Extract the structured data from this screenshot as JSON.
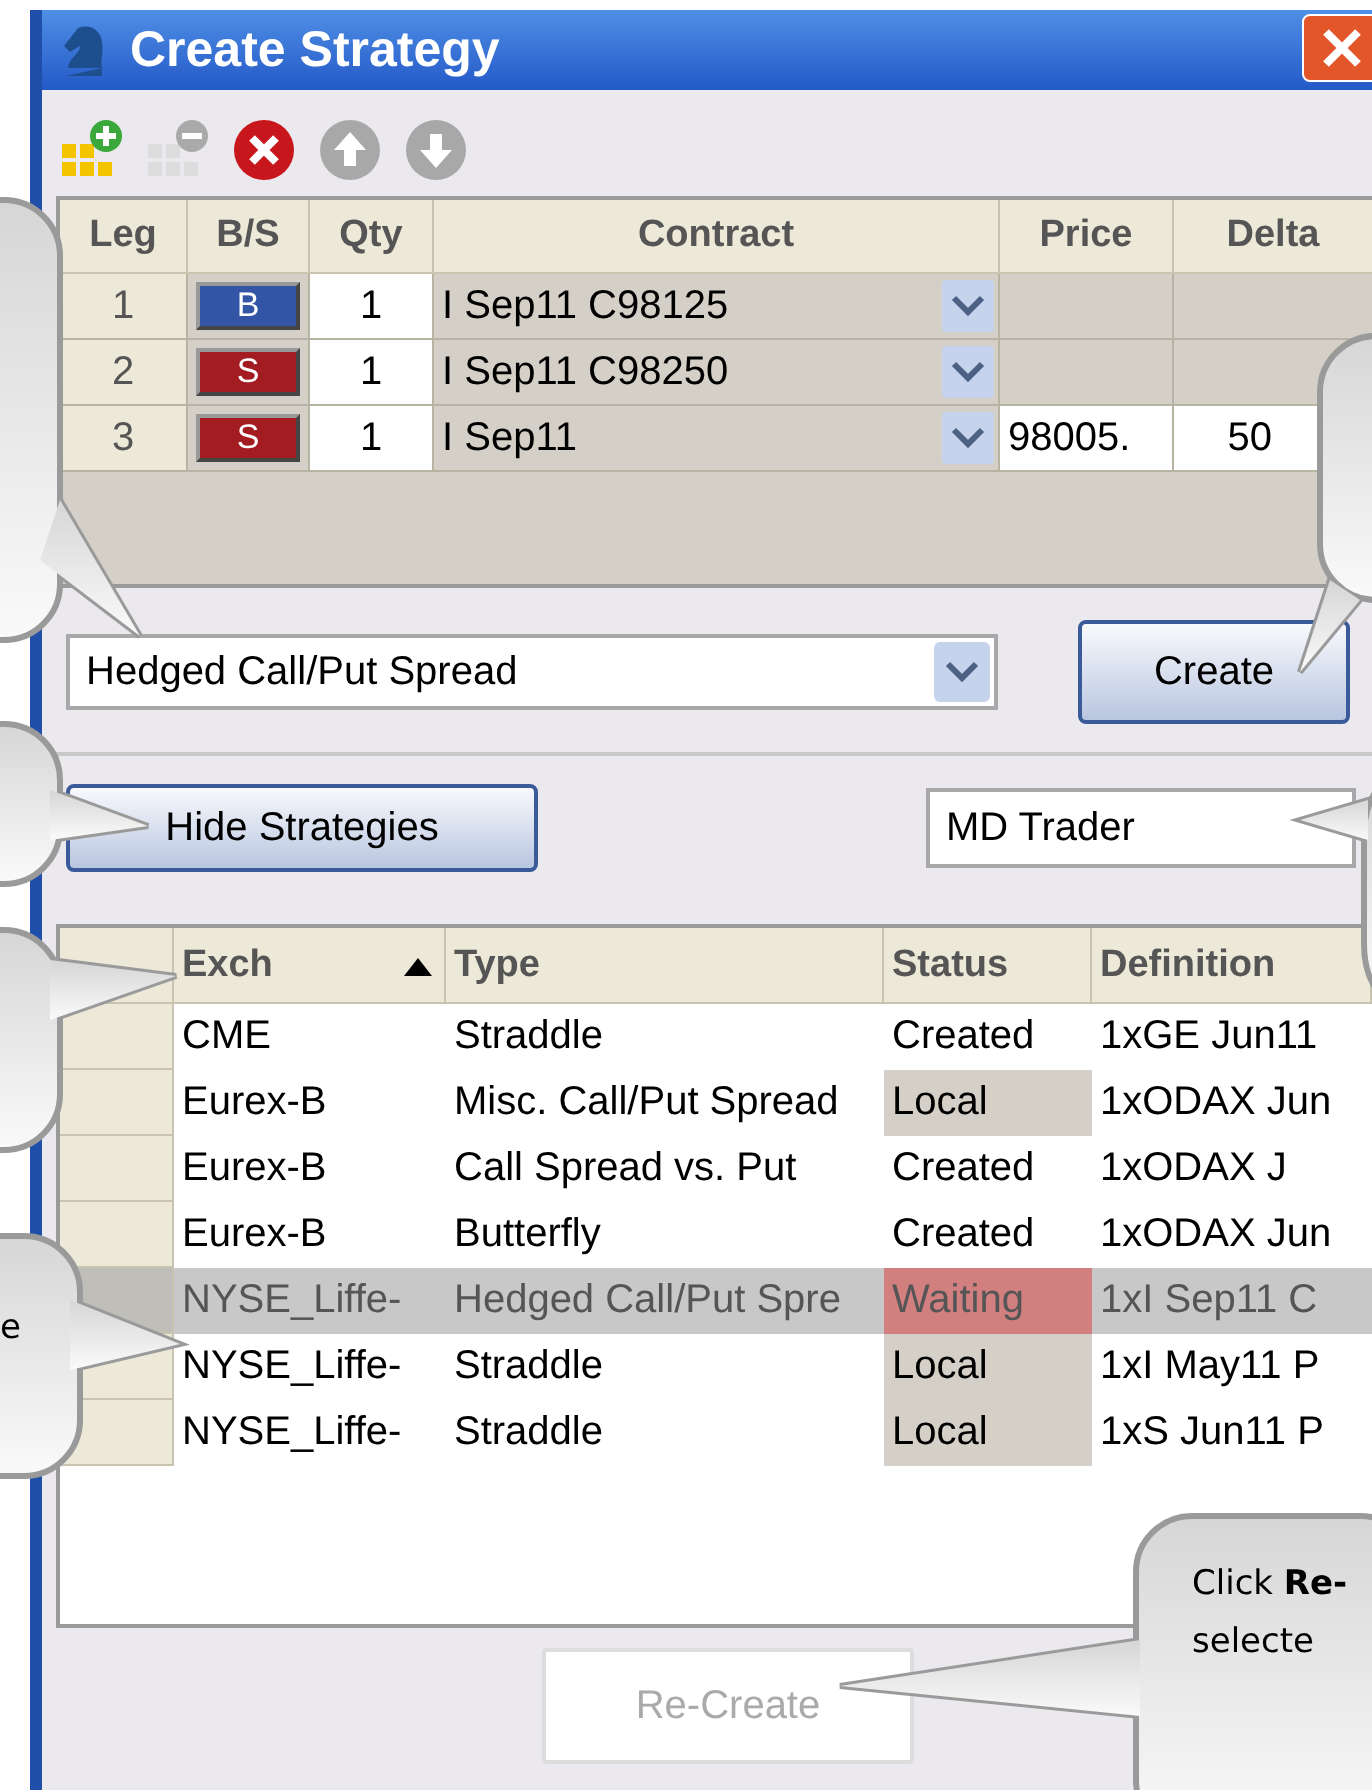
{
  "window": {
    "title": "Create Strategy"
  },
  "legs": {
    "columns": [
      "Leg",
      "B/S",
      "Qty",
      "Contract",
      "Price",
      "Delta"
    ],
    "rows": [
      {
        "leg": "1",
        "side": "B",
        "kind": "buy",
        "qty": "1",
        "contract": "I Sep11 C98125",
        "price": "",
        "delta": ""
      },
      {
        "leg": "2",
        "side": "S",
        "kind": "sell",
        "qty": "1",
        "contract": "I Sep11 C98250",
        "price": "",
        "delta": ""
      },
      {
        "leg": "3",
        "side": "S",
        "kind": "sell",
        "qty": "1",
        "contract": "I Sep11",
        "price": "98005.",
        "delta": "50"
      }
    ]
  },
  "strategy_type": {
    "value": "Hedged Call/Put Spread"
  },
  "create_button": "Create",
  "hide_button": "Hide Strategies",
  "launcher": {
    "value": "MD Trader"
  },
  "strategies": {
    "columns": [
      "Exch",
      "Type",
      "Status",
      "Definition"
    ],
    "rows": [
      {
        "exch": "CME",
        "type": "Straddle",
        "status": "Created",
        "color": "#ffffff",
        "definition": "1xGE Jun11",
        "selected": false
      },
      {
        "exch": "Eurex-B",
        "type": "Misc. Call/Put Spread",
        "status": "Local",
        "color": "#d4d0c8",
        "definition": "1xODAX Jun",
        "selected": false
      },
      {
        "exch": "Eurex-B",
        "type": "Call Spread vs. Put",
        "status": "Created",
        "color": "#ffffff",
        "definition": "1xODAX J",
        "selected": false
      },
      {
        "exch": "Eurex-B",
        "type": "Butterfly",
        "status": "Created",
        "color": "#ffffff",
        "definition": "1xODAX Jun",
        "selected": false
      },
      {
        "exch": "NYSE_Liffe-",
        "type": "Hedged Call/Put Spre",
        "status": "Waiting",
        "color": "#d27f80",
        "definition": "1xI Sep11 C",
        "selected": true
      },
      {
        "exch": "NYSE_Liffe-",
        "type": "Straddle",
        "status": "Local",
        "color": "#d4d0c8",
        "definition": "1xI May11 P",
        "selected": false
      },
      {
        "exch": "NYSE_Liffe-",
        "type": "Straddle",
        "status": "Local",
        "color": "#d4d0c8",
        "definition": "1xS Jun11 P",
        "selected": false
      }
    ]
  },
  "recreate_button": {
    "label": "Re-Create",
    "disabled": true
  },
  "callouts": [
    {
      "text": "e"
    },
    {
      "text": "Click **Re-**\nselecte"
    }
  ]
}
